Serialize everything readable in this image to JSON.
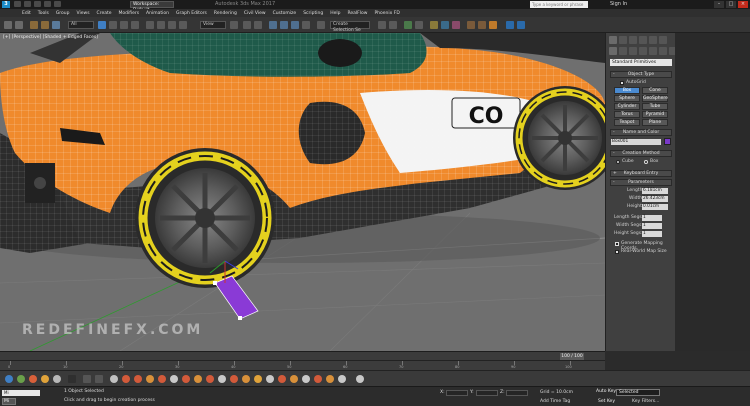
{
  "titlebar": {
    "app_logo": "3",
    "workspace": "Workspace: Default",
    "window_title": "Autodesk 3ds Max 2017",
    "search_placeholder": "Type a keyword or phrase",
    "sign_in": "Sign In",
    "min": "–",
    "max": "□",
    "close": "×"
  },
  "menu": [
    "Edit",
    "Tools",
    "Group",
    "Views",
    "Create",
    "Modifiers",
    "Animation",
    "Graph Editors",
    "Rendering",
    "Civil View",
    "Customize",
    "Scripting",
    "Help",
    "RealFlow",
    "Phoenix FD"
  ],
  "toolbar": {
    "filter_value": "All",
    "view_value": "View",
    "create_selection_value": "Create Selection Se"
  },
  "viewport": {
    "label": "[+] [Perspective] [Shaded + Edged Faces]",
    "watermark": "REDEFINEFX.COM",
    "car_badge": "CO"
  },
  "command_panel": {
    "category": "Standard Primitives",
    "object_type": {
      "title": "Object Type",
      "autogrid": "AutoGrid",
      "buttons": [
        "Box",
        "Cone",
        "Sphere",
        "GeoSphere",
        "Cylinder",
        "Tube",
        "Torus",
        "Pyramid",
        "Teapot",
        "Plane"
      ],
      "active": "Box"
    },
    "name_color": {
      "title": "Name and Color",
      "name": "Box001",
      "color": "#7a39c9"
    },
    "creation_method": {
      "title": "Creation Method",
      "opt1": "Cube",
      "opt2": "Box"
    },
    "keyboard_entry": {
      "title": "Keyboard Entry"
    },
    "parameters": {
      "title": "Parameters",
      "length_label": "Length:",
      "length_value": "6.181cm",
      "width_label": "Width:",
      "width_value": "26.423cm",
      "height_label": "Height:",
      "height_value": "0.01cm",
      "lsegs_label": "Length Segs:",
      "lsegs_value": "1",
      "wsegs_label": "Width Segs:",
      "wsegs_value": "1",
      "hsegs_label": "Height Segs:",
      "hsegs_value": "1",
      "gen_mapping": "Generate Mapping Coords.",
      "real_world": "Real-World Map Size"
    }
  },
  "timeline": {
    "slider": "100 / 100",
    "ticks": [
      "0",
      "10",
      "20",
      "30",
      "40",
      "50",
      "60",
      "70",
      "80",
      "90",
      "100"
    ]
  },
  "status": {
    "maxscript": "Mi",
    "taskbtn": "Mi",
    "selection": "1 Object Selected",
    "prompt": "Click and drag to begin creation process",
    "x_label": "X:",
    "y_label": "Y:",
    "z_label": "Z:",
    "grid": "Grid = 10.0cm",
    "add_time_tag": "Add Time Tag",
    "auto_key": "Auto Key",
    "set_key": "Set Key",
    "selected": "Selected",
    "key_filters": "Key Filters..."
  }
}
